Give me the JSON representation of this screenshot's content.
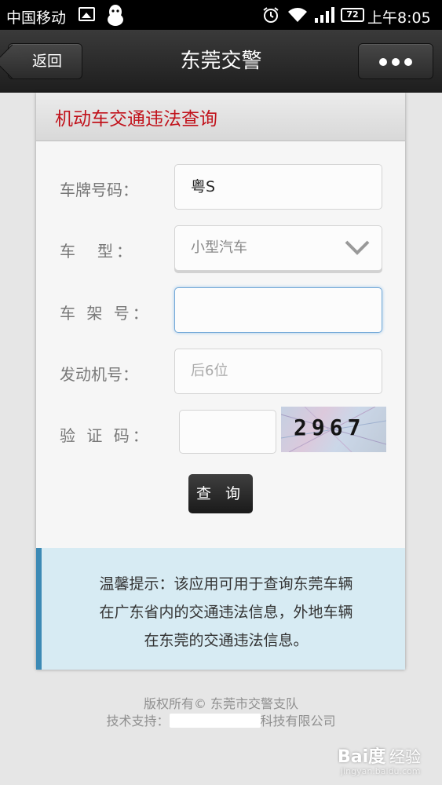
{
  "status_bar": {
    "carrier": "中国移动",
    "battery": "72",
    "time": "上午8:05"
  },
  "nav": {
    "back_label": "返回",
    "title": "东莞交警"
  },
  "form": {
    "title": "机动车交通违法查询",
    "plate": {
      "label": "车牌号码：",
      "value": "粤S"
    },
    "vehicle_type": {
      "label": "车　型：",
      "value": "小型汽车"
    },
    "frame_no": {
      "label": "车 架 号：",
      "value": ""
    },
    "engine_no": {
      "label": "发动机号：",
      "placeholder": "后6位"
    },
    "captcha": {
      "label": "验 证 码：",
      "value": "",
      "image_text": "2967"
    },
    "submit_label": "查 询"
  },
  "tip": {
    "line1": "温馨提示：该应用可用于查询东莞车辆",
    "line2": "在广东省内的交通违法信息，外地车辆",
    "line3": "在东莞的交通违法信息。"
  },
  "footer": {
    "copyright": "版权所有© 东莞市交警支队",
    "tech_prefix": "技术支持：",
    "tech_suffix": "科技有限公司"
  },
  "watermark": {
    "brand": "Bai度",
    "sub": "经验",
    "url": "jingyan.baidu.com"
  },
  "colors": {
    "title_red": "#c1121b",
    "tip_bg": "#d7ebf3",
    "tip_accent": "#3c8ab5",
    "focus_border": "#74a9d8"
  }
}
